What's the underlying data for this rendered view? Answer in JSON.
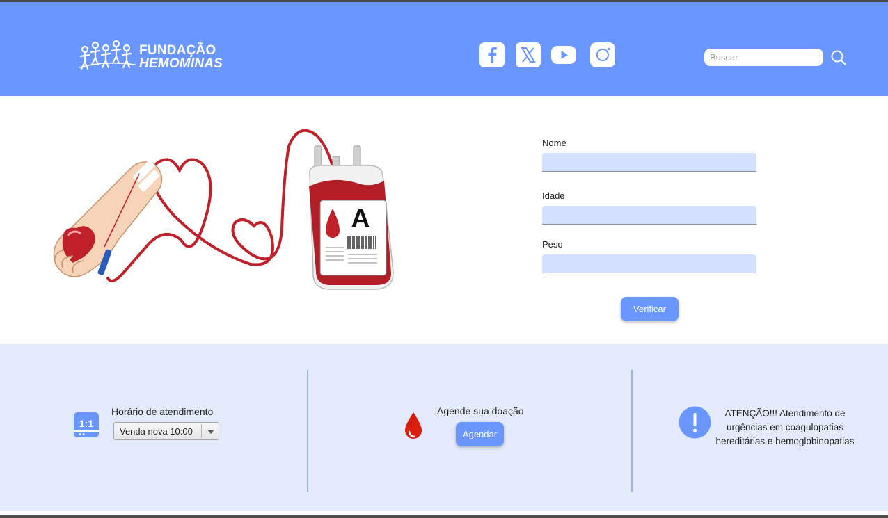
{
  "header": {
    "logo": {
      "line1": "FUNDAÇÃO",
      "line2": "HEMOMINAS"
    },
    "social": [
      "facebook-icon",
      "x-icon",
      "youtube-icon",
      "instagram-icon"
    ],
    "search": {
      "placeholder": "Buscar",
      "value": ""
    }
  },
  "hero": {
    "illustration": {
      "blood_type": "A"
    }
  },
  "form": {
    "fields": [
      {
        "label": "Nome",
        "value": ""
      },
      {
        "label": "Idade",
        "value": ""
      },
      {
        "label": "Peso",
        "value": ""
      }
    ],
    "submit_label": "Verificar"
  },
  "info": {
    "hours": {
      "label": "Horário de atendimento",
      "selected": "Venda nova 10:00"
    },
    "schedule": {
      "label": "Agende sua doação",
      "button": "Agendar"
    },
    "alert": {
      "text": "ATENÇÃO!!! Atendimento de urgências em coagulopatias hereditárias e hemoglobinopatias"
    }
  },
  "colors": {
    "header_bg": "#6996ff",
    "input_bg": "#d3e0ff",
    "info_bg": "#e2eafc",
    "blood_red": "#c0202a",
    "button": "#6996ff"
  }
}
